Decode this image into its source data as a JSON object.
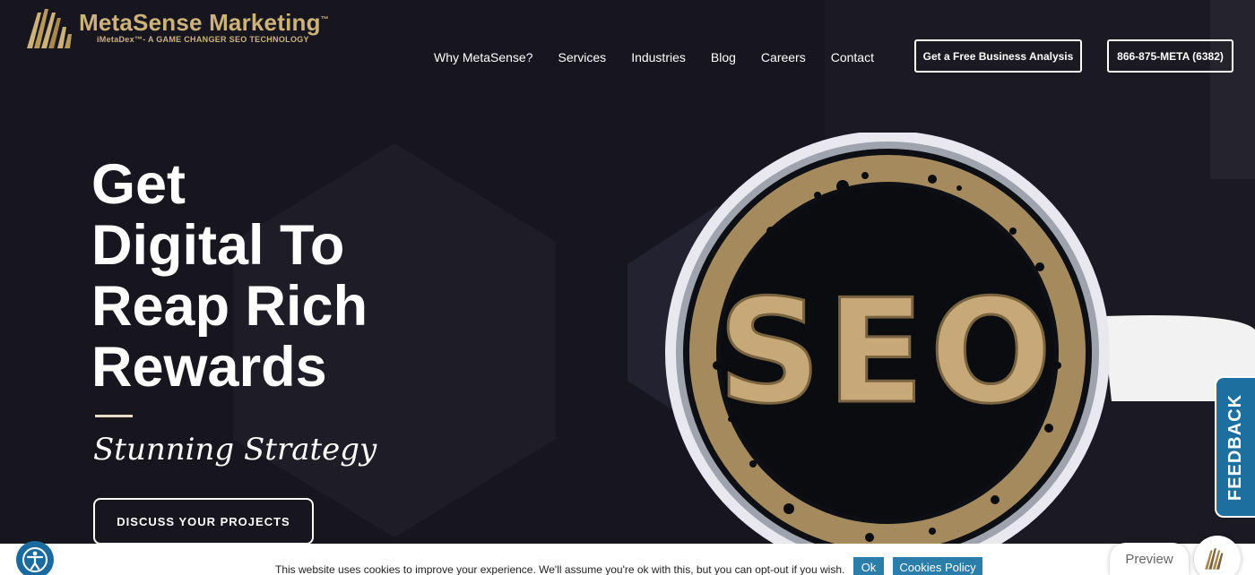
{
  "brand": {
    "name": "MetaSense Marketing",
    "trademark": "™",
    "tagline": "iMetaDex™- A GAME CHANGER SEO TECHNOLOGY",
    "accent_color": "#cdb37a"
  },
  "nav": {
    "items": [
      "Why MetaSense?",
      "Services",
      "Industries",
      "Blog",
      "Careers",
      "Contact"
    ]
  },
  "header_buttons": {
    "analysis": "Get a Free Business Analysis",
    "phone": "866-875-META (6382)"
  },
  "hero": {
    "title_lines": [
      "Get",
      "Digital To",
      "Reap Rich",
      "Rewards"
    ],
    "script_text": "Stunning Strategy",
    "cta": "DISCUSS YOUR PROJECTS",
    "image_text": "SEO"
  },
  "feedback": {
    "label": "FEEDBACK",
    "color": "#1d6fa0"
  },
  "cookie": {
    "text": "This website uses cookies to improve your experience. We'll assume you're ok with this, but you can opt-out if you wish.",
    "ok": "Ok",
    "policy": "Cookies Policy",
    "button_color": "#2a7ea9"
  },
  "widgets": {
    "preview": "Preview",
    "accessibility_icon": "accessibility-icon"
  }
}
